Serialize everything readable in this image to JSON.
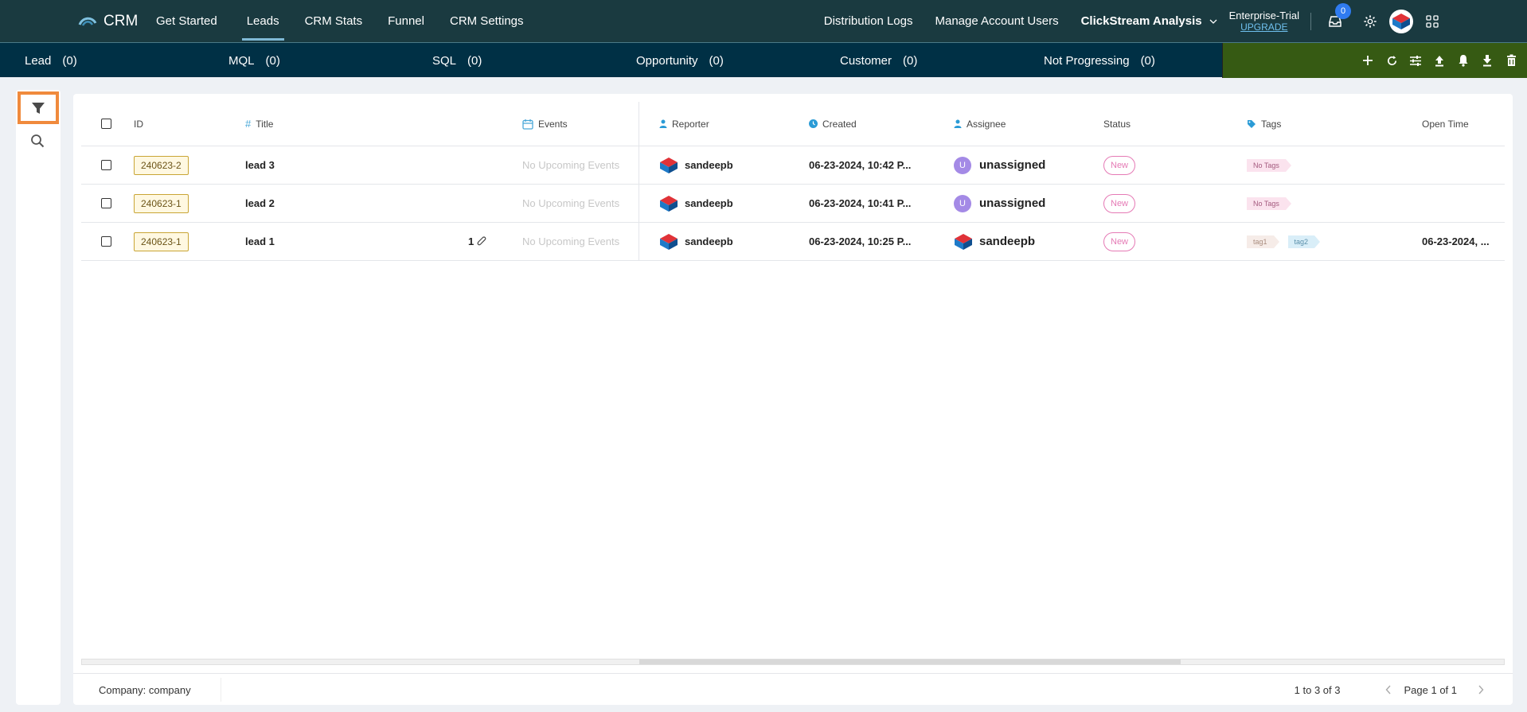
{
  "nav": {
    "brand": "CRM",
    "links": [
      "Get Started",
      "Leads",
      "CRM Stats",
      "Funnel",
      "CRM Settings"
    ],
    "active": "Leads",
    "right_links": [
      "Distribution Logs",
      "Manage Account Users"
    ],
    "clickstream": "ClickStream Analysis",
    "plan": "Enterprise-Trial",
    "upgrade": "UPGRADE",
    "inbox_count": "0"
  },
  "stages": [
    {
      "label": "Lead",
      "count": "(0)"
    },
    {
      "label": "MQL",
      "count": "(0)"
    },
    {
      "label": "SQL",
      "count": "(0)"
    },
    {
      "label": "Opportunity",
      "count": "(0)"
    },
    {
      "label": "Customer",
      "count": "(0)"
    },
    {
      "label": "Not Progressing",
      "count": "(0)"
    }
  ],
  "table": {
    "columns": {
      "id": "ID",
      "title": "Title",
      "events": "Events",
      "reporter": "Reporter",
      "created": "Created",
      "assignee": "Assignee",
      "status": "Status",
      "tags": "Tags",
      "open_time": "Open Time"
    },
    "rows": [
      {
        "id": "240623-2",
        "title": "lead 3",
        "attachments": "",
        "events": "No Upcoming Events",
        "reporter": "sandeepb",
        "created": "06-23-2024, 10:42 P...",
        "assignee_initial": "U",
        "assignee": "unassigned",
        "status": "New",
        "tags": [
          "No Tags"
        ],
        "open_time": ""
      },
      {
        "id": "240623-1",
        "title": "lead 2",
        "attachments": "",
        "events": "No Upcoming Events",
        "reporter": "sandeepb",
        "created": "06-23-2024, 10:41 P...",
        "assignee_initial": "U",
        "assignee": "unassigned",
        "status": "New",
        "tags": [
          "No Tags"
        ],
        "open_time": ""
      },
      {
        "id": "240623-1",
        "title": "lead 1",
        "attachments": "1",
        "events": "No Upcoming Events",
        "reporter": "sandeepb",
        "created": "06-23-2024, 10:25 P...",
        "assignee_initial": "",
        "assignee": "sandeepb",
        "status": "New",
        "tags": [
          "tag1",
          "tag2"
        ],
        "open_time": "06-23-2024, ..."
      }
    ]
  },
  "footer": {
    "company": "Company: company",
    "range": "1 to 3 of 3",
    "page": "Page 1 of 1"
  },
  "colors": {
    "topnav": "#1a3a40",
    "statusbar": "#003045",
    "actionbar": "#365a13",
    "highlight": "#f08a3c"
  }
}
